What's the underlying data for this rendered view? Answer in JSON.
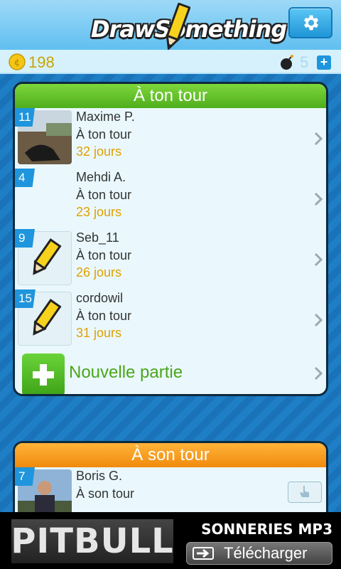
{
  "header": {
    "logo_text": "DrawSomething",
    "settings_icon": "gear-icon"
  },
  "status": {
    "coins": "198",
    "bombs": "5",
    "add_bomb_label": "+"
  },
  "your_turn": {
    "title": "À ton tour",
    "games": [
      {
        "badge": "11",
        "name": "Maxime P.",
        "status": "À ton tour",
        "elapsed": "32 jours",
        "thumb": "photo"
      },
      {
        "badge": "4",
        "name": "Mehdi A.",
        "status": "À ton tour",
        "elapsed": "23 jours",
        "thumb": "blank"
      },
      {
        "badge": "9",
        "name": "Seb_11",
        "status": "À ton tour",
        "elapsed": "26 jours",
        "thumb": "pencil-icon"
      },
      {
        "badge": "15",
        "name": "cordowil",
        "status": "À ton tour",
        "elapsed": "31 jours",
        "thumb": "pencil-icon"
      }
    ],
    "new_game_label": "Nouvelle partie"
  },
  "their_turn": {
    "title": "À son tour",
    "games": [
      {
        "badge": "7",
        "name": "Boris G.",
        "status": "À son tour",
        "thumb": "photo"
      }
    ]
  },
  "ad": {
    "brand": "PITBULL",
    "headline": "SONNERIES MP3",
    "button_label": "Télécharger"
  },
  "colors": {
    "green_header": "#4fae1c",
    "orange_header": "#f08a0c",
    "badge_blue": "#1e95dc",
    "elapsed_gold": "#e0a000"
  }
}
